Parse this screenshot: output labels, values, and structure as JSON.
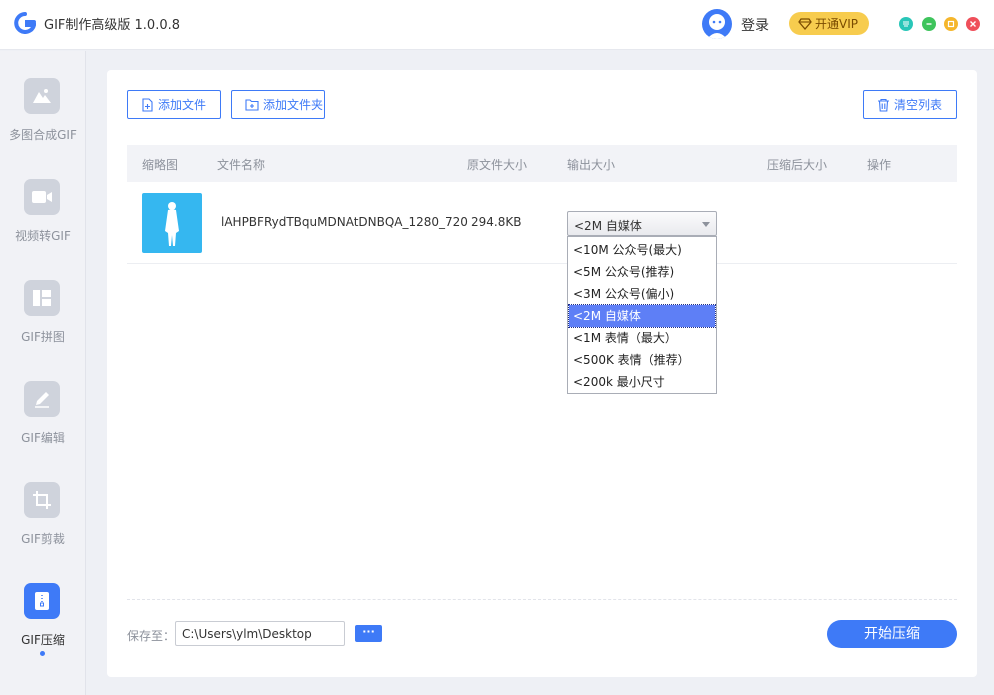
{
  "app": {
    "title": "GIF制作高级版 1.0.0.8"
  },
  "header": {
    "login_label": "登录",
    "vip_label": "开通VIP"
  },
  "colors": {
    "accent": "#3e7af7",
    "vip": "#f7cc4e",
    "close": "#ef4f5a",
    "minimize": "#3ec45c",
    "maximize": "#f5b62c",
    "menu": "#29c6b8"
  },
  "sidebar": {
    "items": [
      {
        "label": "多图合成GIF",
        "icon": "image-icon"
      },
      {
        "label": "视频转GIF",
        "icon": "video-icon"
      },
      {
        "label": "GIF拼图",
        "icon": "layout-icon"
      },
      {
        "label": "GIF编辑",
        "icon": "edit-icon"
      },
      {
        "label": "GIF剪裁",
        "icon": "crop-icon"
      },
      {
        "label": "GIF压缩",
        "icon": "compress-icon",
        "active": true
      }
    ]
  },
  "toolbar": {
    "add_file": "添加文件",
    "add_folder": "添加文件夹",
    "clear_list": "清空列表"
  },
  "table": {
    "headers": [
      "缩略图",
      "文件名称",
      "原文件大小",
      "输出大小",
      "压缩后大小",
      "操作"
    ],
    "rows": [
      {
        "name": "lAHPBFRydTBquMDNAtDNBQA_1280_720",
        "size": "294.8KB",
        "output": "<2M 自媒体"
      }
    ]
  },
  "dropdown": {
    "options": [
      "<10M 公众号(最大)",
      "<5M 公众号(推荐)",
      "<3M 公众号(偏小)",
      "<2M 自媒体",
      "<1M 表情（最大）",
      "<500K 表情（推荐）",
      "<200k 最小尺寸"
    ],
    "selected_index": 3
  },
  "footer": {
    "save_label": "保存至：",
    "save_path": "C:\\Users\\ylm\\Desktop",
    "browse_label": "···",
    "start_label": "开始压缩"
  }
}
